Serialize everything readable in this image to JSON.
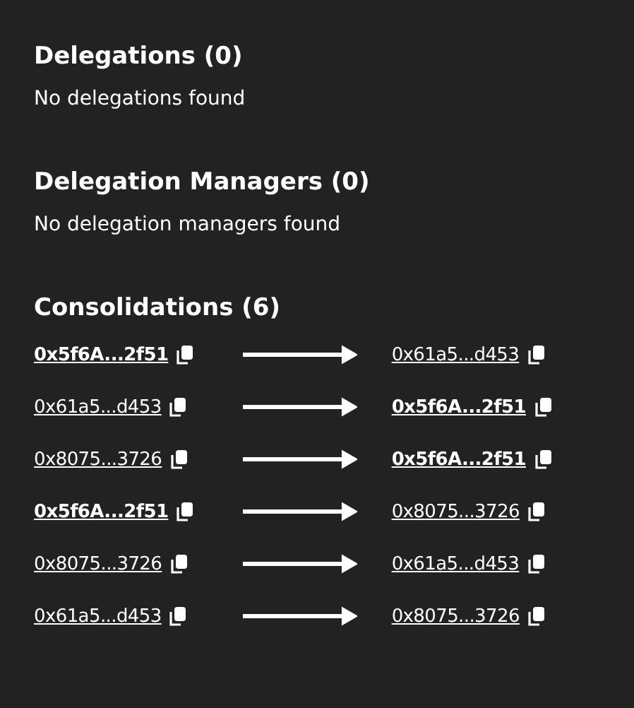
{
  "delegations": {
    "title": "Delegations (0)",
    "empty": "No delegations found"
  },
  "delegation_managers": {
    "title": "Delegation Managers (0)",
    "empty": "No delegation managers found"
  },
  "consolidations": {
    "title": "Consolidations (6)",
    "rows": [
      {
        "from": {
          "address": "0x5f6A...2f51",
          "highlighted": true
        },
        "to": {
          "address": "0x61a5...d453",
          "highlighted": false
        }
      },
      {
        "from": {
          "address": "0x61a5...d453",
          "highlighted": false
        },
        "to": {
          "address": "0x5f6A...2f51",
          "highlighted": true
        }
      },
      {
        "from": {
          "address": "0x8075...3726",
          "highlighted": false
        },
        "to": {
          "address": "0x5f6A...2f51",
          "highlighted": true
        }
      },
      {
        "from": {
          "address": "0x5f6A...2f51",
          "highlighted": true
        },
        "to": {
          "address": "0x8075...3726",
          "highlighted": false
        }
      },
      {
        "from": {
          "address": "0x8075...3726",
          "highlighted": false
        },
        "to": {
          "address": "0x61a5...d453",
          "highlighted": false
        }
      },
      {
        "from": {
          "address": "0x61a5...d453",
          "highlighted": false
        },
        "to": {
          "address": "0x8075...3726",
          "highlighted": false
        }
      }
    ]
  }
}
